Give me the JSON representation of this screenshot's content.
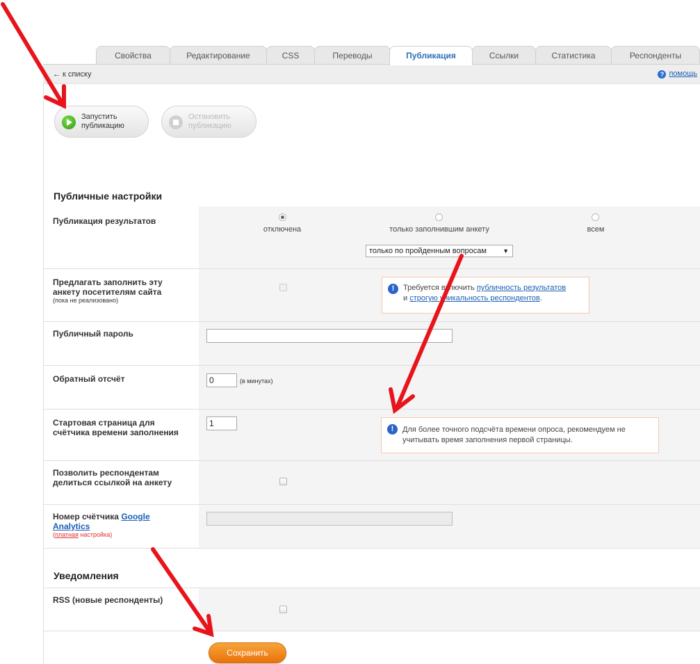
{
  "tabs": [
    {
      "label": "Свойства",
      "active": false
    },
    {
      "label": "Редактирование",
      "active": false
    },
    {
      "label": "CSS",
      "active": false
    },
    {
      "label": "Переводы",
      "active": false
    },
    {
      "label": "Публикация",
      "active": true
    },
    {
      "label": "Ссылки",
      "active": false
    },
    {
      "label": "Статистика",
      "active": false
    },
    {
      "label": "Респонденты",
      "active": false
    }
  ],
  "nav": {
    "back_label": "← к списку",
    "help_label": "помощь",
    "help_icon": "question-icon"
  },
  "actions": {
    "start_label_line1": "Запустить",
    "start_label_line2": "публикацию",
    "stop_label_line1": "Остановить",
    "stop_label_line2": "публикацию"
  },
  "public_settings": {
    "title": "Публичные настройки",
    "results_publication": {
      "label": "Публикация результатов",
      "options": [
        "отключена",
        "только заполнившим анкету",
        "всем"
      ],
      "selected": "отключена",
      "scope_select": "только по пройденным вопросам"
    },
    "offer_fill": {
      "label": "Предлагать заполнить эту анкету посетителям сайта",
      "sublabel": "(пока не реализовано)",
      "note_prefix": "Требуется включить",
      "note_link1": "публичность результатов",
      "note_and": "и",
      "note_link2": "строгую уникальность респондентов",
      "note_suffix": "."
    },
    "password": {
      "label": "Публичный пароль",
      "value": ""
    },
    "countdown": {
      "label": "Обратный отсчёт",
      "value": "0",
      "unit": "(в минутах)"
    },
    "start_page": {
      "label": "Стартовая страница для счётчика времени заполнения",
      "value": "1",
      "note_line1": "Для более точного подсчёта времени опроса, рекомендуем не",
      "note_line2": "учитывать время заполнения первой страницы."
    },
    "share": {
      "label": "Позволить респондентам делиться ссылкой на анкету"
    },
    "analytics": {
      "label_prefix": "Номер счётчика",
      "label_link1": "Google",
      "label_link2": "Analytics",
      "paid_open": "(",
      "paid_link": "платная",
      "paid_rest": "настройка)",
      "value": ""
    }
  },
  "notifications": {
    "title": "Уведомления",
    "rss": {
      "label": "RSS (новые респонденты)"
    }
  },
  "save_label": "Сохранить",
  "colors": {
    "accent_tab": "#2a6fb8",
    "save": "#e9720c",
    "arrow": "#e8141b",
    "note_border": "#f3c9ad"
  }
}
